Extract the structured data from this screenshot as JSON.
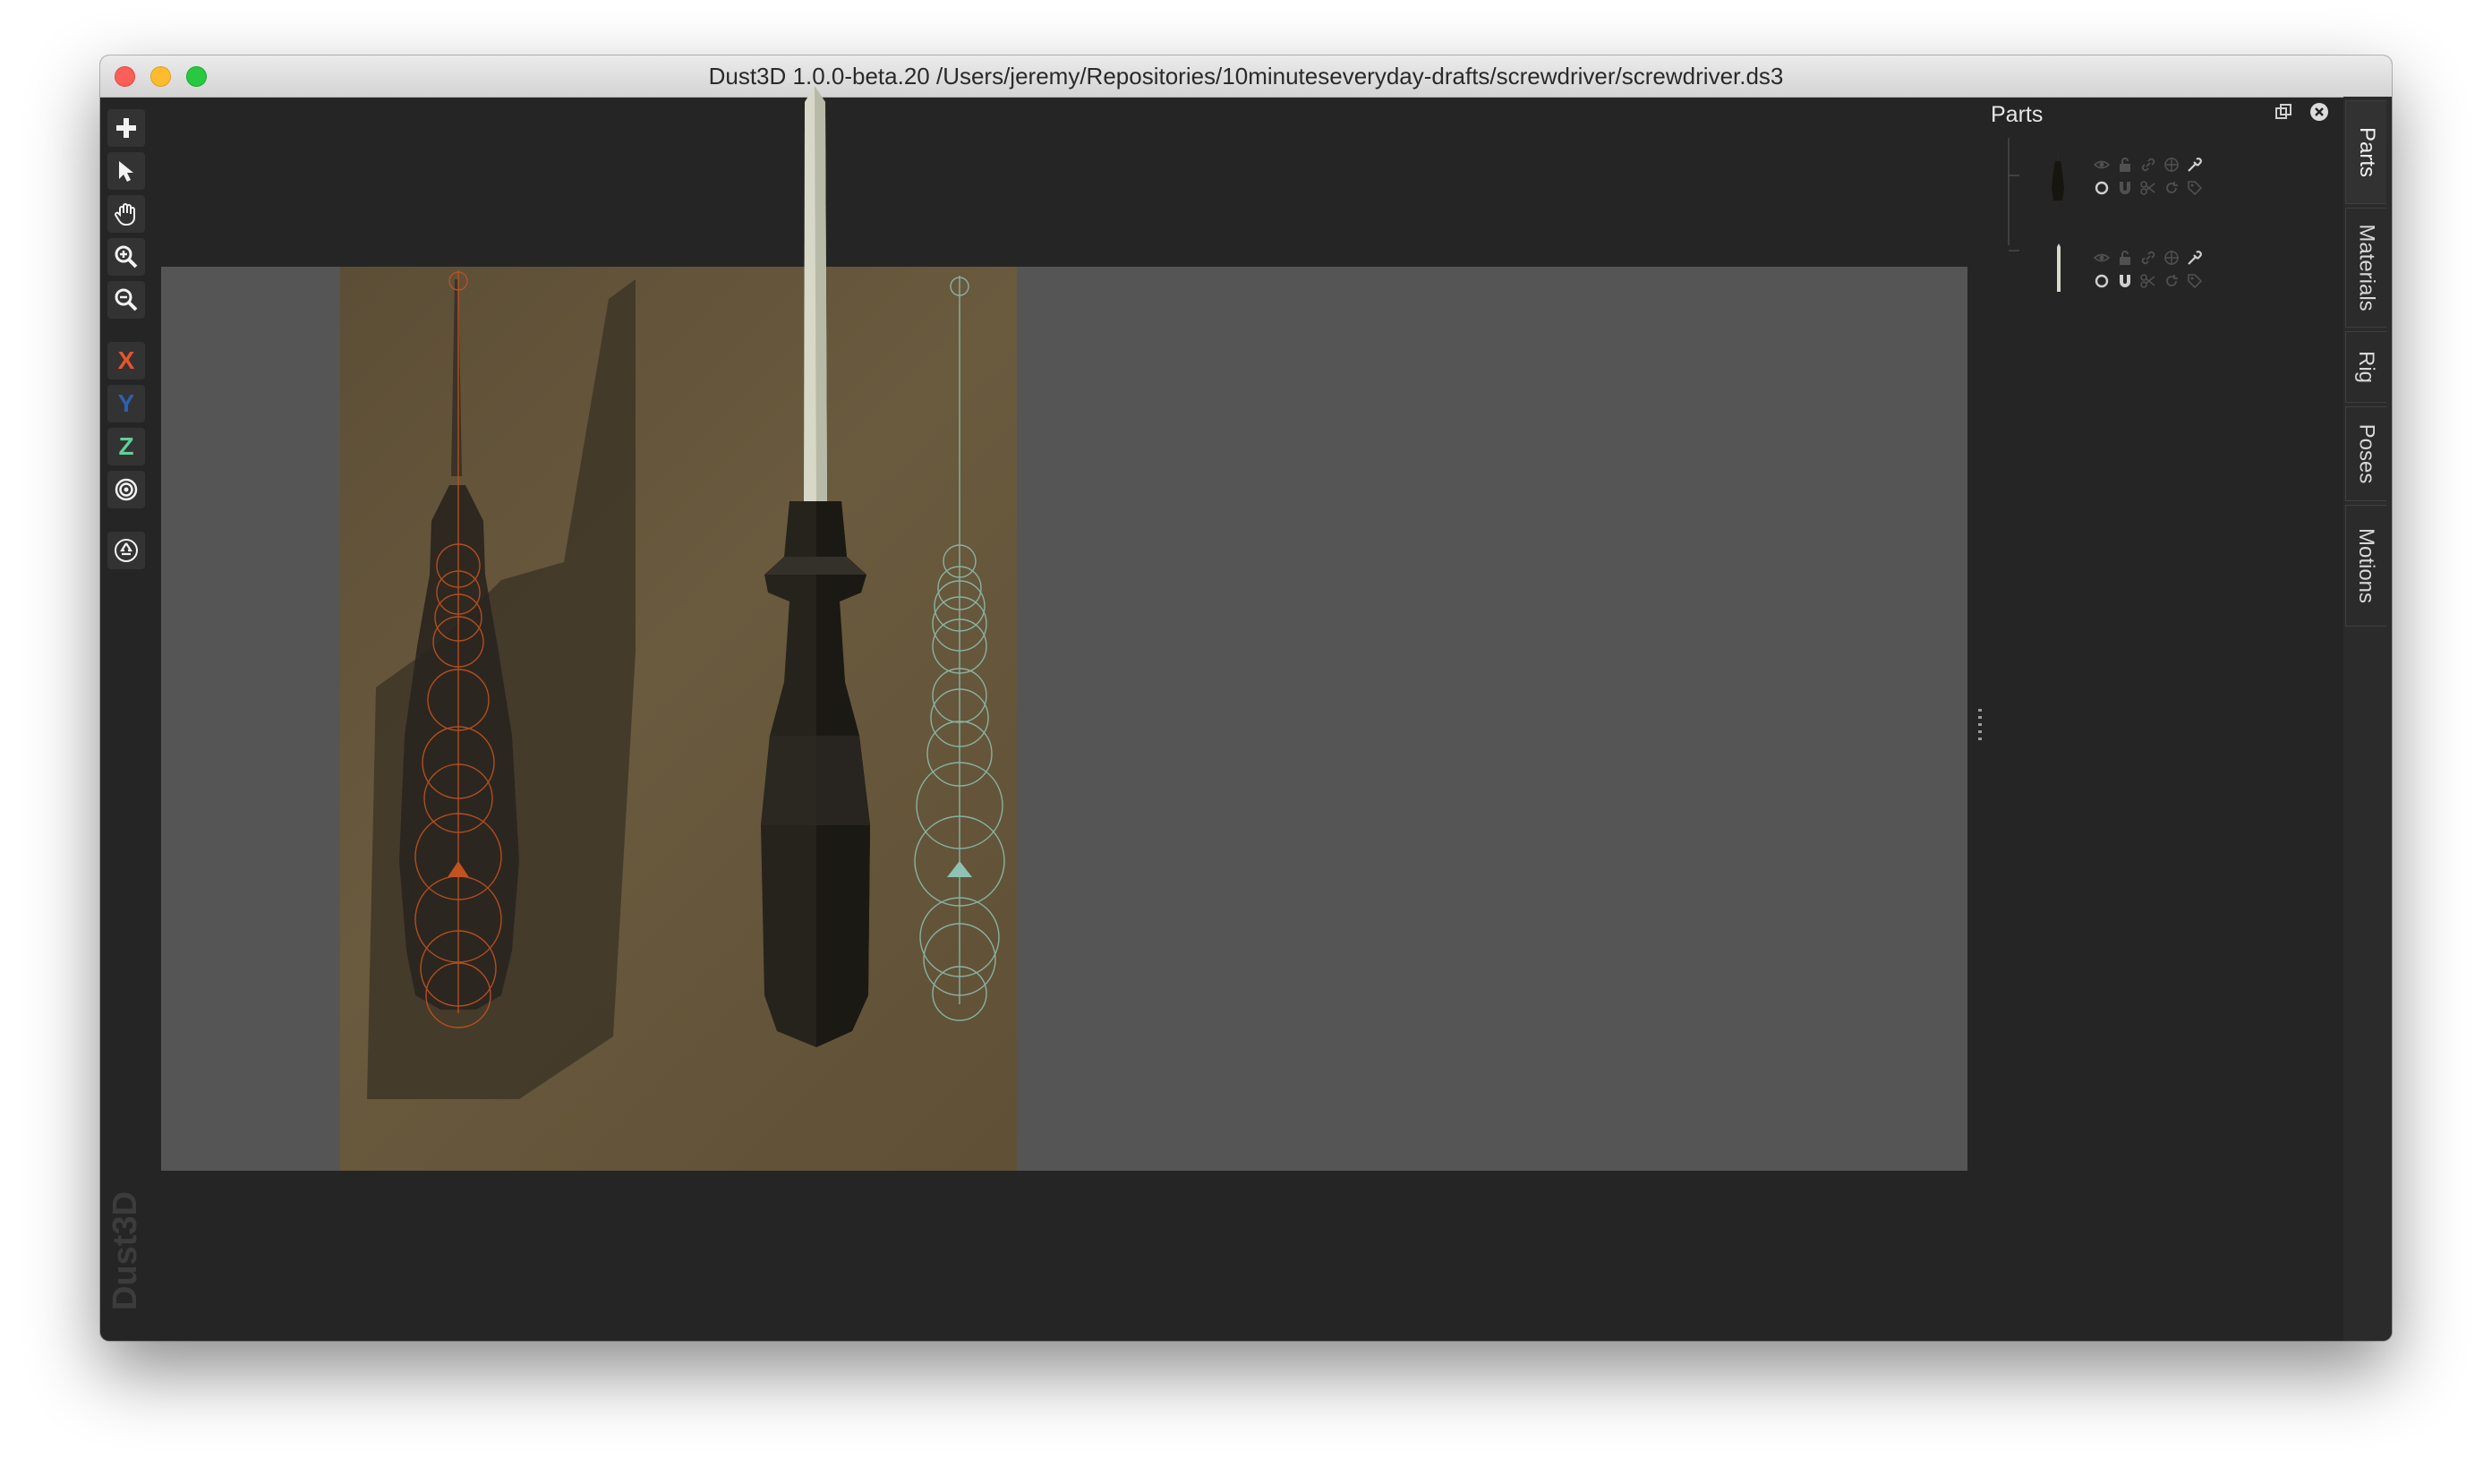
{
  "window": {
    "title": "Dust3D 1.0.0-beta.20 /Users/jeremy/Repositories/10minuteseveryday-drafts/screwdriver/screwdriver.ds3"
  },
  "toolbar": {
    "tools": [
      {
        "name": "add-icon"
      },
      {
        "name": "select-arrow-icon"
      },
      {
        "name": "hand-pan-icon"
      },
      {
        "name": "zoom-in-icon"
      },
      {
        "name": "zoom-out-icon"
      }
    ],
    "axis_x": "X",
    "axis_y": "Y",
    "axis_z": "Z",
    "radius_icon": "target-radius-icon",
    "regenerate_icon": "recycle-icon",
    "axis_colors": {
      "x": "#e8542c",
      "y": "#2f5fb0",
      "z": "#5fcf9a"
    }
  },
  "brand": "Dust3D",
  "parts_panel": {
    "title": "Parts",
    "float_icon": "float-window-icon",
    "close_icon": "close-icon",
    "items": [
      {
        "preview": "screwdriver-handle-preview",
        "icons": [
          "eye-icon",
          "lock-icon",
          "link-icon",
          "symmetry-icon",
          "color-picker-icon",
          "circle-icon",
          "magnet-icon",
          "scissors-icon",
          "rotate-icon",
          "tag-icon"
        ]
      },
      {
        "preview": "screwdriver-shaft-preview",
        "icons": [
          "eye-icon",
          "lock-icon",
          "link-icon",
          "symmetry-icon",
          "color-picker-icon",
          "circle-icon",
          "magnet-icon",
          "scissors-icon",
          "rotate-icon",
          "tag-icon"
        ]
      }
    ]
  },
  "side_tabs": [
    "Parts",
    "Materials",
    "Rig",
    "Poses",
    "Motions"
  ]
}
